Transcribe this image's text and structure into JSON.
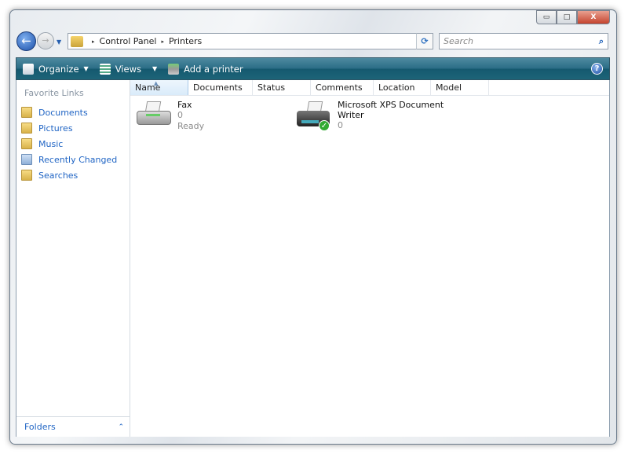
{
  "window": {
    "min_label": "▭",
    "max_label": "□",
    "close_label": "X"
  },
  "nav": {
    "back": "←",
    "forward": "→",
    "history": "▼"
  },
  "address": {
    "crumbs": [
      "Control Panel",
      "Printers"
    ],
    "separator": "▸",
    "dropdown": "▼",
    "refresh": "⟳"
  },
  "search": {
    "placeholder": "Search",
    "icon": "⌕"
  },
  "toolbar": {
    "organize": "Organize",
    "views": "Views",
    "add_printer": "Add a printer",
    "arrow": "▼",
    "help": "?"
  },
  "sidebar": {
    "title": "Favorite Links",
    "items": [
      {
        "label": "Documents"
      },
      {
        "label": "Pictures"
      },
      {
        "label": "Music"
      },
      {
        "label": "Recently Changed"
      },
      {
        "label": "Searches"
      }
    ],
    "folders": "Folders",
    "folders_toggle": "⌃"
  },
  "columns": [
    "Name",
    "Documents",
    "Status",
    "Comments",
    "Location",
    "Model"
  ],
  "sort_indicator": "▲",
  "printers": [
    {
      "name": "Fax",
      "documents": "0",
      "status": "Ready"
    },
    {
      "name_line1": "Microsoft XPS Document",
      "name_line2": "Writer",
      "documents": "0",
      "default_mark": "✓"
    }
  ]
}
